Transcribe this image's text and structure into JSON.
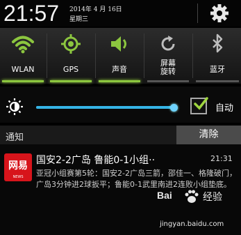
{
  "header": {
    "time": "21:57",
    "date": "2014年 4 月 16日",
    "weekday": "星期三",
    "settings_icon": "gear-icon"
  },
  "quick_settings": [
    {
      "label": "WLAN",
      "icon": "wifi-icon",
      "on": true
    },
    {
      "label": "GPS",
      "icon": "gps-icon",
      "on": true
    },
    {
      "label": "声音",
      "icon": "sound-icon",
      "on": true
    },
    {
      "label": "屏幕\n旋转",
      "icon": "rotate-icon",
      "on": false
    },
    {
      "label": "蓝牙",
      "icon": "bluetooth-icon",
      "on": false
    }
  ],
  "brightness": {
    "level": 0.99,
    "auto_label": "自动",
    "auto_checked": true
  },
  "notifications_bar": {
    "title": "通知",
    "clear_label": "清除"
  },
  "notification": {
    "app_name": "网易",
    "app_sub": "NEWS",
    "title": "国安2-2广岛 鲁能0-1小组··",
    "time": "21:31",
    "body": "亚冠小组赛第5轮：国安2-2广岛三箭，邵佳一、格隆破门，广岛3分钟进2球扳平；鲁能0-1武里南进2连败小组垫底。"
  },
  "watermark": {
    "logo": "Bai",
    "suffix": "经验",
    "url": "jingyan.baidu.com"
  },
  "colors": {
    "accent_green": "#8cc63f",
    "slider_blue": "#35b4e5",
    "netease_red": "#d7141b"
  }
}
